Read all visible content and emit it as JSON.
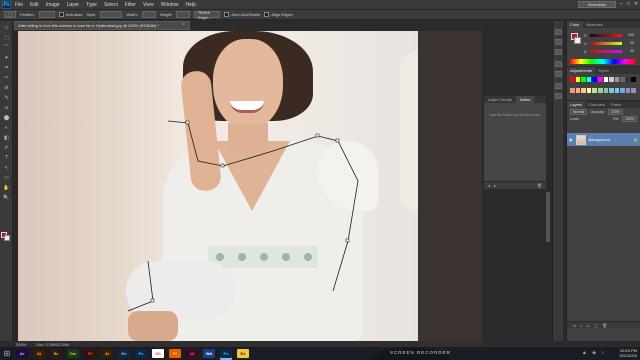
{
  "app": {
    "logo": "Ps",
    "menu": [
      "File",
      "Edit",
      "Image",
      "Layer",
      "Type",
      "Select",
      "Filter",
      "View",
      "Window",
      "Help"
    ],
    "workspace": "Essentials",
    "window_controls": [
      "–",
      "□",
      "✕"
    ]
  },
  "options": {
    "feather_label": "Feather:",
    "feather_value": "",
    "antialias_label": "Anti-alias",
    "style_label": "Style:",
    "style_value": "",
    "width_label": "Width:",
    "height_label": "Height:",
    "refine_edge": "Refine Edge...",
    "auto_add_delete": "Auto Add/Delete",
    "align_edges": "Align Edges"
  },
  "document": {
    "tab_title": "After falling in love this actress to lose fat in Hyderabad.jpg @ 200% (RGB/8#) *",
    "close": "×",
    "zoom": "200%",
    "doc_size": "Doc: 2.29M/2.29M"
  },
  "tools": [
    "⊹",
    "⬚",
    "⌒",
    "✦",
    "⌗",
    "✂",
    "⊘",
    "✎",
    "⌀",
    "⬤",
    "◐",
    "◧",
    "✐",
    "T",
    "↖",
    "▭",
    "✋",
    "🔍"
  ],
  "mid_panel": {
    "tabs": [
      "Layer Comps",
      "Notes"
    ],
    "message": "Use the Notes tool to add a note"
  },
  "color_panel": {
    "tabs": [
      "Color",
      "Swatches"
    ],
    "fg_color": "#c8141e",
    "bg_color": "#f0f0f0",
    "r": {
      "label": "R",
      "value": "200"
    },
    "g": {
      "label": "G",
      "value": "20"
    },
    "b": {
      "label": "B",
      "value": "30"
    }
  },
  "adjust_panel": {
    "tabs": [
      "Adjustments",
      "Styles"
    ],
    "swatches": [
      "#ff0000",
      "#ffff00",
      "#00ff00",
      "#00ffff",
      "#0000ff",
      "#ff00ff",
      "#ffffff",
      "#cccccc",
      "#999999",
      "#666666",
      "#333333",
      "#000000",
      "#f7977a",
      "#f9ad81",
      "#fdc68a",
      "#fff79a",
      "#c4df9b",
      "#a2d39c",
      "#82ca9d",
      "#7bcdc8",
      "#6ecff6",
      "#7ea7d8",
      "#8493ca",
      "#a187be"
    ]
  },
  "layers_panel": {
    "tabs": [
      "Layers",
      "Channels",
      "Paths"
    ],
    "blend_mode": "Normal",
    "opacity_label": "Opacity:",
    "opacity_value": "100%",
    "lock_label": "Lock:",
    "fill_label": "Fill:",
    "fill_value": "100%",
    "layer_name": "Background",
    "footer_icons": [
      "fx",
      "◐",
      "▭",
      "▢",
      "🗑"
    ]
  },
  "taskbar": {
    "apps": [
      {
        "label": "Ae",
        "bg": "#1f0a3c",
        "fg": "#c8a8ff"
      },
      {
        "label": "Ai",
        "bg": "#3a1e00",
        "fg": "#ffb25a"
      },
      {
        "label": "Br",
        "bg": "#2b1e10",
        "fg": "#e6b36a"
      },
      {
        "label": "Dw",
        "bg": "#1c3a16",
        "fg": "#8fe05a"
      },
      {
        "label": "Fl",
        "bg": "#3a0f06",
        "fg": "#ff6a3a"
      },
      {
        "label": "Ai",
        "bg": "#3a1e00",
        "fg": "#ffb25a"
      },
      {
        "label": "En",
        "bg": "#0d2840",
        "fg": "#7cc4ff"
      },
      {
        "label": "Ps",
        "bg": "#0a2a4a",
        "fg": "#4fb0ff"
      },
      {
        "label": "Ch",
        "bg": "#ffffff",
        "fg": "#d93025"
      },
      {
        "label": "Ff",
        "bg": "#e66000",
        "fg": "#ffe066"
      },
      {
        "label": "Id",
        "bg": "#3d0824",
        "fg": "#ff6bb0"
      },
      {
        "label": "Wd",
        "bg": "#1a3f8a",
        "fg": "#ffffff"
      },
      {
        "label": "Ps",
        "bg": "#0a2a4a",
        "fg": "#4fb0ff"
      },
      {
        "label": "Ex",
        "bg": "#f5c542",
        "fg": "#3a2a00"
      }
    ],
    "watermark": "SCREEN RECORDER",
    "time": "10:53 PM",
    "date": "9/11/2020"
  }
}
